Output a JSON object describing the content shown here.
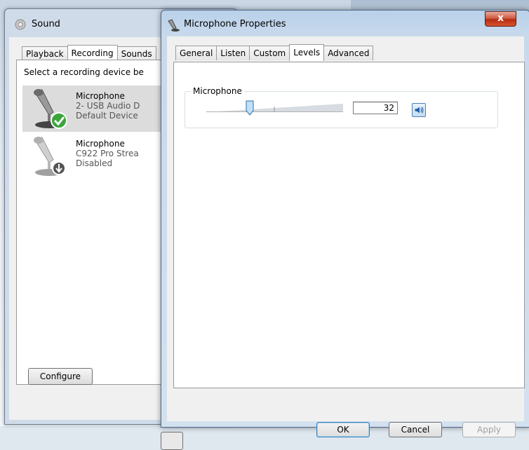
{
  "sound_window": {
    "title": "Sound",
    "tabs": [
      {
        "label": "Playback",
        "active": false
      },
      {
        "label": "Recording",
        "active": true
      },
      {
        "label": "Sounds",
        "active": false
      }
    ],
    "instruction": "Select a recording device be",
    "devices": [
      {
        "name": "Microphone",
        "sub": "2- USB Audio D",
        "status": "Default Device",
        "selected": true,
        "icon": "microphone-default-icon"
      },
      {
        "name": "Microphone",
        "sub": "C922 Pro Strea",
        "status": "Disabled",
        "selected": false,
        "icon": "microphone-disabled-icon"
      }
    ],
    "configure_label": "Configure"
  },
  "mic_window": {
    "title": "Microphone Properties",
    "close_label": "x",
    "tabs": [
      {
        "label": "General",
        "active": false
      },
      {
        "label": "Listen",
        "active": false
      },
      {
        "label": "Custom",
        "active": false
      },
      {
        "label": "Levels",
        "active": true
      },
      {
        "label": "Advanced",
        "active": false
      }
    ],
    "levels": {
      "group_label": "Microphone",
      "value": "32",
      "slider_fraction": 0.32
    },
    "buttons": {
      "ok": "OK",
      "cancel": "Cancel",
      "apply": "Apply"
    }
  },
  "colors": {
    "accent": "#3c7fb1",
    "close": "#c8402a"
  }
}
